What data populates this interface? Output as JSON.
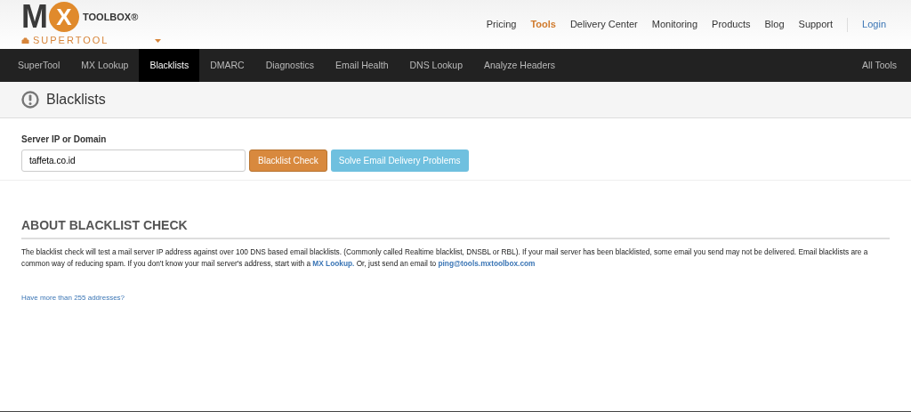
{
  "logo": {
    "m": "M",
    "x": "X",
    "name": "TOOLBOX",
    "registered": "®",
    "product": "SUPERTOOL"
  },
  "top_nav": [
    {
      "label": "Pricing",
      "selected": false
    },
    {
      "label": "Tools",
      "selected": true
    },
    {
      "label": "Delivery Center",
      "selected": false
    },
    {
      "label": "Monitoring",
      "selected": false
    },
    {
      "label": "Products",
      "selected": false
    },
    {
      "label": "Blog",
      "selected": false
    },
    {
      "label": "Support",
      "selected": false
    }
  ],
  "login": "Login",
  "tool_tabs": [
    {
      "label": "SuperTool",
      "selected": false
    },
    {
      "label": "MX Lookup",
      "selected": false
    },
    {
      "label": "Blacklists",
      "selected": true
    },
    {
      "label": "DMARC",
      "selected": false
    },
    {
      "label": "Diagnostics",
      "selected": false
    },
    {
      "label": "Email Health",
      "selected": false
    },
    {
      "label": "DNS Lookup",
      "selected": false
    },
    {
      "label": "Analyze Headers",
      "selected": false
    }
  ],
  "all_tools": "All Tools",
  "page_title": "Blacklists",
  "form": {
    "label": "Server IP or Domain",
    "value": "taffeta.co.id",
    "primary_button": "Blacklist Check",
    "secondary_button": "Solve Email Delivery Problems"
  },
  "about": {
    "heading": "ABOUT BLACKLIST CHECK",
    "paragraph": [
      {
        "kind": "text",
        "text": "The blacklist check will test a mail server IP address against over 100 DNS based email blacklists. (Commonly called Realtime blacklist, DNSBL or RBL).  If your mail server has been blacklisted, some email you send may not be delivered.  Email blacklists are a common way of reducing spam.  If you don't know your mail server's address, start with a "
      },
      {
        "kind": "link",
        "text": "MX Lookup."
      },
      {
        "kind": "text",
        "text": "   Or, just send an email to "
      },
      {
        "kind": "link",
        "text": "ping@tools.mxtoolbox.com"
      }
    ],
    "more_link": "Have more than 255 addresses?"
  }
}
